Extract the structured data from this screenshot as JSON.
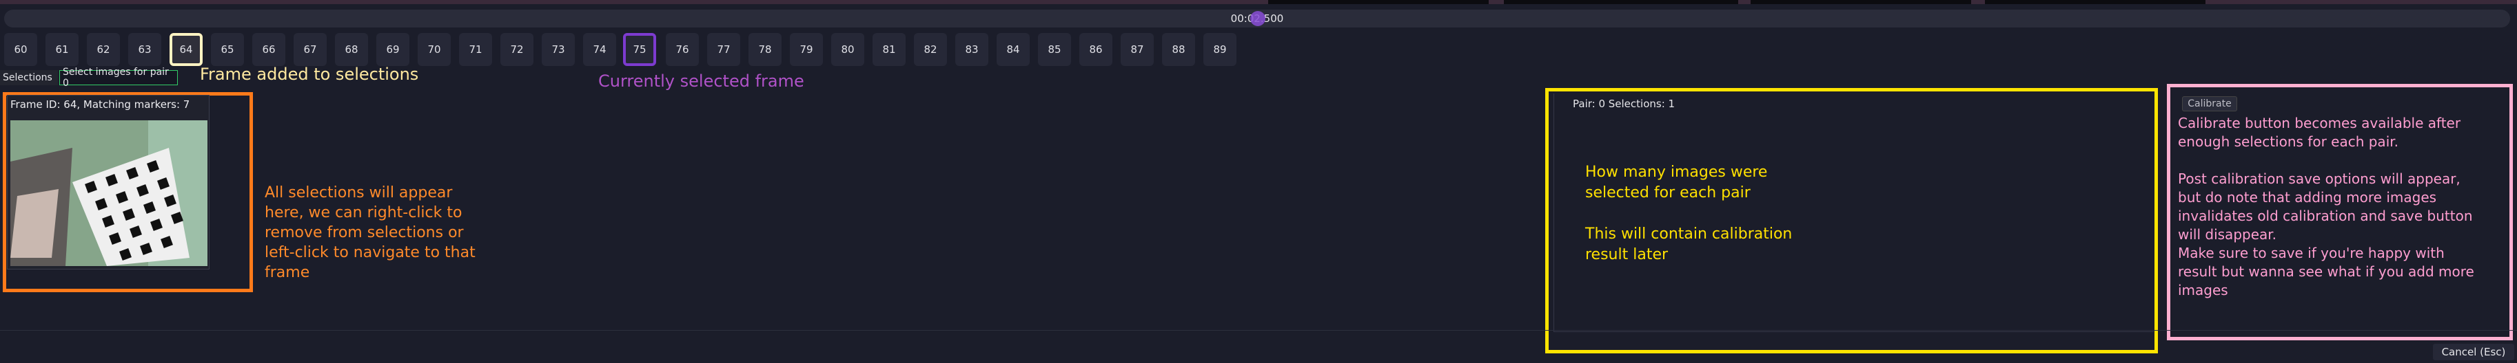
{
  "timeline": {
    "time": "00:02.500"
  },
  "frames": {
    "items": [
      "60",
      "61",
      "62",
      "63",
      "64",
      "65",
      "66",
      "67",
      "68",
      "69",
      "70",
      "71",
      "72",
      "73",
      "74",
      "75",
      "76",
      "77",
      "78",
      "79",
      "80",
      "81",
      "82",
      "83",
      "84",
      "85",
      "86",
      "87",
      "88",
      "89"
    ]
  },
  "tabs": {
    "selections": "Selections",
    "pair": "Select images for pair 0"
  },
  "annotations": {
    "frame_added": "Frame added to selections",
    "currently_selected": "Currently selected frame",
    "selections_info": "All selections will appear here, we can right-click to remove from selections or left-click to navigate to that frame",
    "pair_info_1": "How many images were selected for each pair",
    "pair_info_2": "This will contain calibration result later",
    "calibrate_info_1": "Calibrate button becomes available after enough selections for each pair.",
    "calibrate_info_2": "Post calibration save options will appear, but do note that adding more images invalidates old calibration and save button will disappear.",
    "calibrate_info_3": "Make sure to save if you're happy with result but wanna see what if you add more images"
  },
  "selection_card": {
    "caption": "Frame ID: 64, Matching markers: 7"
  },
  "pair_panel": {
    "label": "Pair: 0 Selections: 1"
  },
  "buttons": {
    "calibrate": "Calibrate",
    "cancel": "Cancel (Esc)"
  },
  "colors": {
    "orange": "#ff7a1a",
    "yellow": "#ffe400",
    "pink": "#ffb0d0",
    "purple": "#7d3bd0",
    "added_frame": "#fff3c2"
  }
}
